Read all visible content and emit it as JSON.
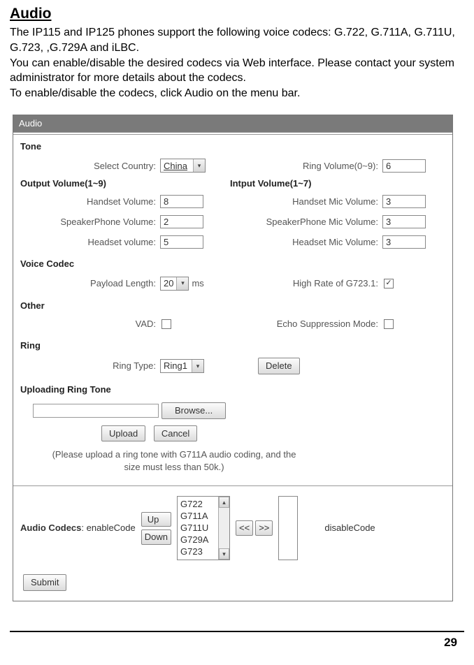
{
  "heading": "Audio",
  "intro": "The IP115 and IP125 phones support the following voice codecs: G.722, G.711A, G.711U, G.723, ,G.729A and iLBC.\nYou can enable/disable the desired codecs via Web interface. Please contact your system administrator for more details about the codecs.\nTo enable/disable the codecs, click Audio on the menu bar.",
  "panel": {
    "title": "Audio",
    "tone": {
      "section": "Tone",
      "select_country_label": "Select Country:",
      "select_country_value": "China",
      "ring_volume_label": "Ring Volume(0~9):",
      "ring_volume_value": "6"
    },
    "output_section": "Output Volume(1~9)",
    "input_section": "Intput Volume(1~7)",
    "volumes": {
      "handset_label": "Handset Volume:",
      "handset_value": "8",
      "handset_mic_label": "Handset Mic Volume:",
      "handset_mic_value": "3",
      "speaker_label": "SpeakerPhone Volume:",
      "speaker_value": "2",
      "speaker_mic_label": "SpeakerPhone Mic Volume:",
      "speaker_mic_value": "3",
      "headset_label": "Headset volume:",
      "headset_value": "5",
      "headset_mic_label": "Headset Mic Volume:",
      "headset_mic_value": "3"
    },
    "voice_codec": {
      "section": "Voice Codec",
      "payload_label": "Payload Length:",
      "payload_value": "20",
      "payload_unit": "ms",
      "highrate_label": "High Rate of G723.1:",
      "highrate_checked": "✓"
    },
    "other": {
      "section": "Other",
      "vad_label": "VAD:",
      "echo_label": "Echo Suppression Mode:"
    },
    "ring": {
      "section": "Ring",
      "ring_type_label": "Ring Type:",
      "ring_type_value": "Ring1",
      "delete_label": "Delete"
    },
    "upload": {
      "section": "Uploading Ring Tone",
      "browse_label": "Browse...",
      "upload_label": "Upload",
      "cancel_label": "Cancel",
      "note": "(Please upload a ring tone with G711A audio coding, and the size must less than 50k.)"
    },
    "codecs": {
      "enable_label_bold": "Audio Codecs",
      "enable_label_rest": ": enableCode",
      "up_label": "Up",
      "down_label": "Down",
      "list": [
        "G722",
        "G711A",
        "G711U",
        "G729A",
        "G723"
      ],
      "move_left": "<<",
      "move_right": ">>",
      "disable_label": "disableCode"
    },
    "submit_label": "Submit"
  },
  "page_number": "29"
}
